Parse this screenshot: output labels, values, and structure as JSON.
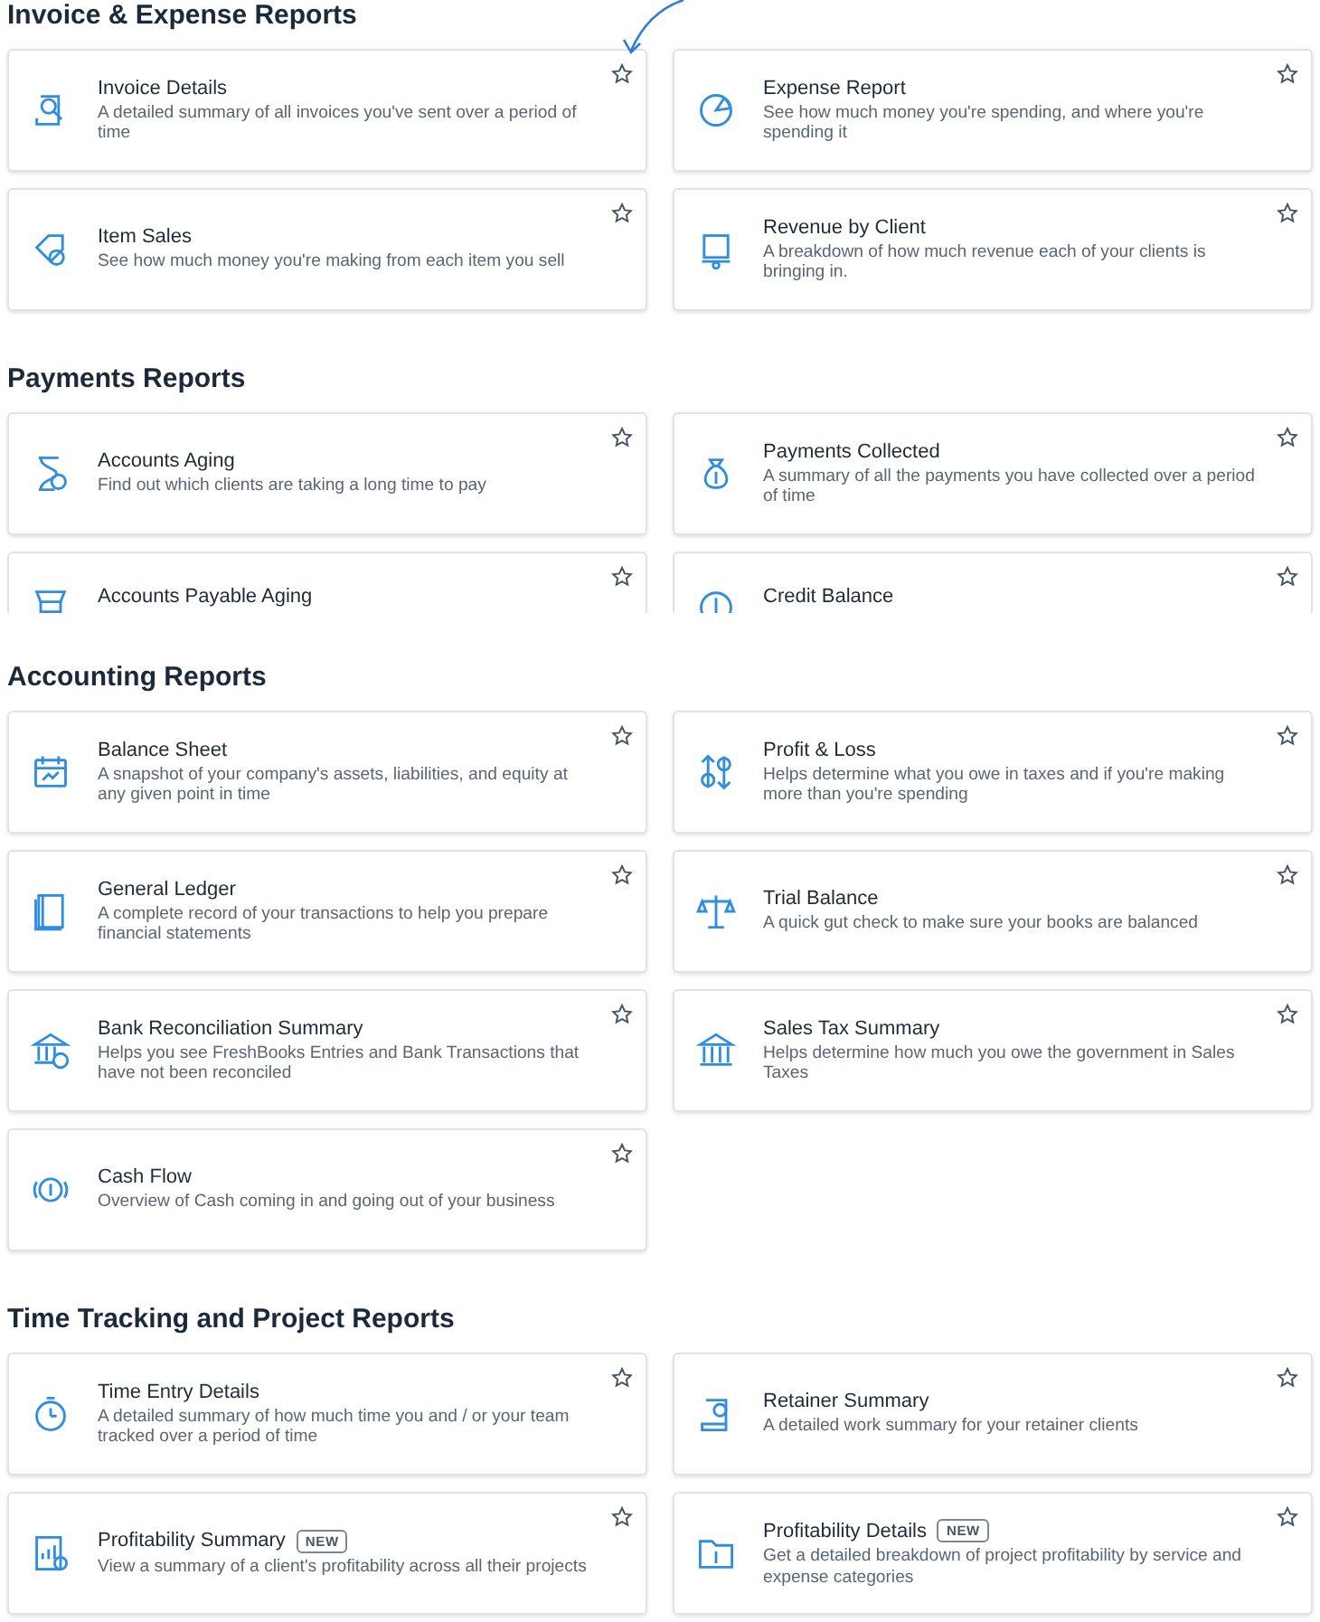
{
  "sections": [
    {
      "title": "Invoice & Expense Reports",
      "cards": [
        {
          "title": "Invoice Details",
          "description": "A detailed summary of all invoices you've sent over a period of time",
          "starred": false
        },
        {
          "title": "Expense Report",
          "description": "See how much money you're spending, and where you're spending it",
          "starred": false
        },
        {
          "title": "Item Sales",
          "description": "See how much money you're making from each item you sell",
          "starred": false
        },
        {
          "title": "Revenue by Client",
          "description": "A breakdown of how much revenue each of your clients is bringing in.",
          "starred": false
        }
      ]
    },
    {
      "title": "Payments Reports",
      "cards": [
        {
          "title": "Accounts Aging",
          "description": "Find out which clients are taking a long time to pay",
          "starred": false
        },
        {
          "title": "Payments Collected",
          "description": "A summary of all the payments you have collected over a period of time",
          "starred": false
        },
        {
          "title": "Accounts Payable Aging",
          "starred": false,
          "cut_off": true
        },
        {
          "title": "Credit Balance",
          "starred": false,
          "cut_off": true
        }
      ]
    },
    {
      "title": "Accounting Reports",
      "cards": [
        {
          "title": "Balance Sheet",
          "description": "A snapshot of your company's assets, liabilities, and equity at any given point in time",
          "starred": false
        },
        {
          "title": "Profit & Loss",
          "description": "Helps determine what you owe in taxes and if you're making more than you're spending",
          "starred": false
        },
        {
          "title": "General Ledger",
          "description": "A complete record of your transactions to help you prepare financial statements",
          "starred": false
        },
        {
          "title": "Trial Balance",
          "description": "A quick gut check to make sure your books are balanced",
          "starred": false
        },
        {
          "title": "Bank Reconciliation Summary",
          "description": "Helps you see FreshBooks Entries and Bank Transactions that have not been reconciled",
          "starred": false
        },
        {
          "title": "Sales Tax Summary",
          "description": "Helps determine how much you owe the government in Sales Taxes",
          "starred": false
        },
        {
          "title": "Cash Flow",
          "description": "Overview of Cash coming in and going out of your business",
          "starred": false
        }
      ]
    },
    {
      "title": "Time Tracking and Project Reports",
      "cards": [
        {
          "title": "Time Entry Details",
          "description": "A detailed summary of how much time you and / or your team tracked over a period of time",
          "starred": false
        },
        {
          "title": "Retainer Summary",
          "description": "A detailed work summary for your retainer clients",
          "starred": false
        },
        {
          "title": "Profitability Summary",
          "badge": "NEW",
          "description": "View a summary of a client's profitability across all their projects",
          "starred": false
        },
        {
          "title": "Profitability Details",
          "badge": "NEW",
          "description": "Get a detailed breakdown of project profitability by service and expense categories",
          "starred": false
        }
      ]
    }
  ]
}
